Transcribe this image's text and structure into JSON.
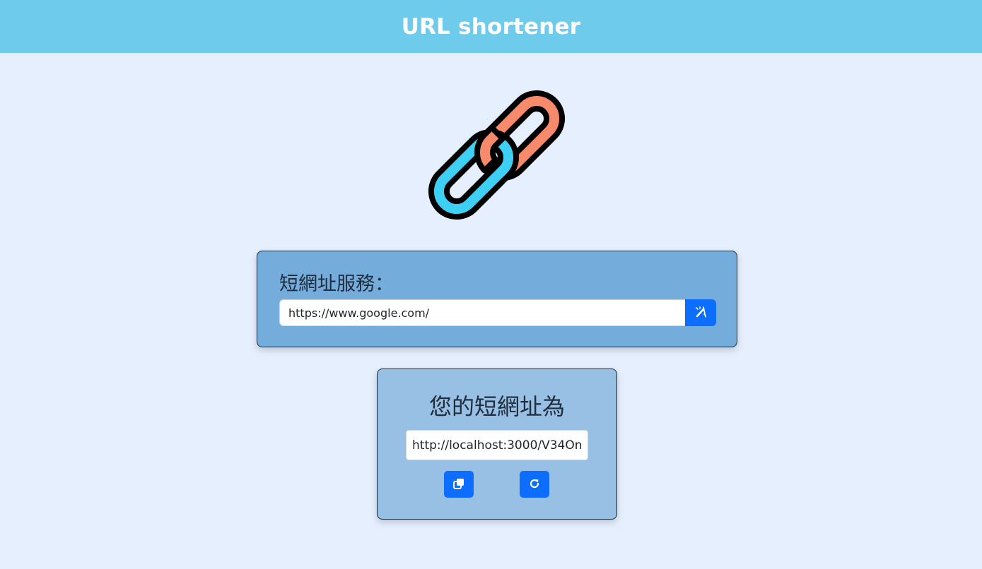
{
  "header": {
    "title": "URL shortener"
  },
  "logo": {
    "icon": "chain-link-icon",
    "colors": {
      "left_link": "#3ecff4",
      "right_link": "#f78a6a",
      "outline": "#000000"
    }
  },
  "form": {
    "label": "短網址服務：",
    "input_value": "https://www.google.com/",
    "submit_icon": "magic-wand-icon"
  },
  "result": {
    "title": "您的短網址為",
    "short_url": "http://localhost:3000/V34On",
    "copy_icon": "copy-icon",
    "reload_icon": "reload-icon"
  },
  "colors": {
    "navbar": "#6ecbec",
    "background": "#e6effe",
    "form_card": "#74acdc",
    "result_card": "#98bfe4",
    "primary_button": "#0d6efd"
  }
}
